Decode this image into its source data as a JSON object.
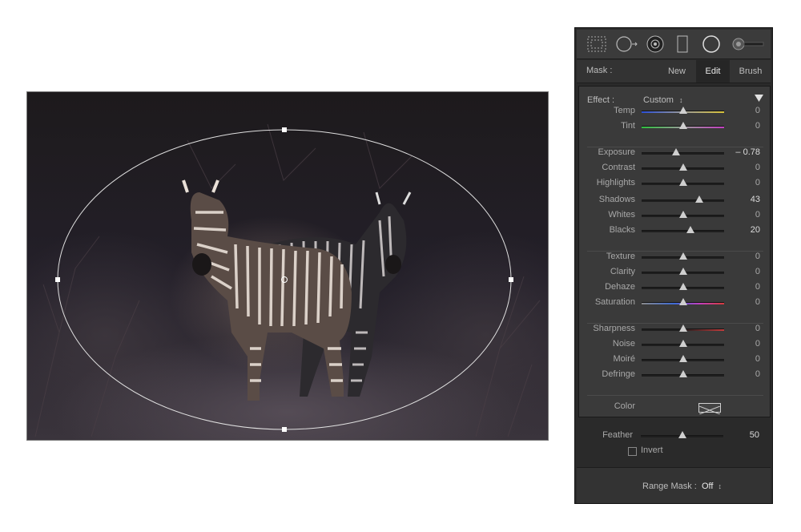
{
  "photo": {
    "description_icon": "zebra-photo"
  },
  "toolbar": {
    "tools": [
      {
        "name": "graduated-filter-icon"
      },
      {
        "name": "radial-filter-icon"
      },
      {
        "name": "red-eye-icon"
      },
      {
        "name": "crop-icon"
      },
      {
        "name": "circle-spot-icon"
      },
      {
        "name": "brush-slider-icon"
      }
    ]
  },
  "mask": {
    "label": "Mask :",
    "new_label": "New",
    "edit_label": "Edit",
    "brush_label": "Brush",
    "active": "Edit"
  },
  "effect": {
    "label": "Effect :",
    "preset": "Custom",
    "preset_arrows": "↕"
  },
  "sliders": [
    {
      "key": "temp",
      "label": "Temp",
      "value": "0",
      "pos": 0.5,
      "gradient": "temp"
    },
    {
      "key": "tint",
      "label": "Tint",
      "value": "0",
      "pos": 0.5,
      "gradient": "tint"
    },
    {
      "key": "exposure",
      "label": "Exposure",
      "value": "– 0.78",
      "pos": 0.42,
      "gradient": "none"
    },
    {
      "key": "contrast",
      "label": "Contrast",
      "value": "0",
      "pos": 0.5,
      "gradient": "none"
    },
    {
      "key": "highlights",
      "label": "Highlights",
      "value": "0",
      "pos": 0.5,
      "gradient": "none"
    },
    {
      "key": "shadows",
      "label": "Shadows",
      "value": "43",
      "pos": 0.7,
      "gradient": "none"
    },
    {
      "key": "whites",
      "label": "Whites",
      "value": "0",
      "pos": 0.5,
      "gradient": "none"
    },
    {
      "key": "blacks",
      "label": "Blacks",
      "value": "20",
      "pos": 0.59,
      "gradient": "none"
    },
    {
      "key": "texture",
      "label": "Texture",
      "value": "0",
      "pos": 0.5,
      "gradient": "none"
    },
    {
      "key": "clarity",
      "label": "Clarity",
      "value": "0",
      "pos": 0.5,
      "gradient": "none"
    },
    {
      "key": "dehaze",
      "label": "Dehaze",
      "value": "0",
      "pos": 0.5,
      "gradient": "none"
    },
    {
      "key": "saturation",
      "label": "Saturation",
      "value": "0",
      "pos": 0.5,
      "gradient": "sat"
    },
    {
      "key": "sharpness",
      "label": "Sharpness",
      "value": "0",
      "pos": 0.5,
      "gradient": "sharp"
    },
    {
      "key": "noise",
      "label": "Noise",
      "value": "0",
      "pos": 0.5,
      "gradient": "none"
    },
    {
      "key": "moire",
      "label": "Moiré",
      "value": "0",
      "pos": 0.5,
      "gradient": "none"
    },
    {
      "key": "defringe",
      "label": "Defringe",
      "value": "0",
      "pos": 0.5,
      "gradient": "none"
    }
  ],
  "color": {
    "label": "Color"
  },
  "feather": {
    "label": "Feather",
    "value": "50",
    "pos": 0.5
  },
  "invert": {
    "label": "Invert",
    "checked": false
  },
  "range_mask": {
    "label": "Range Mask :",
    "value": "Off",
    "arrows": "↕"
  }
}
